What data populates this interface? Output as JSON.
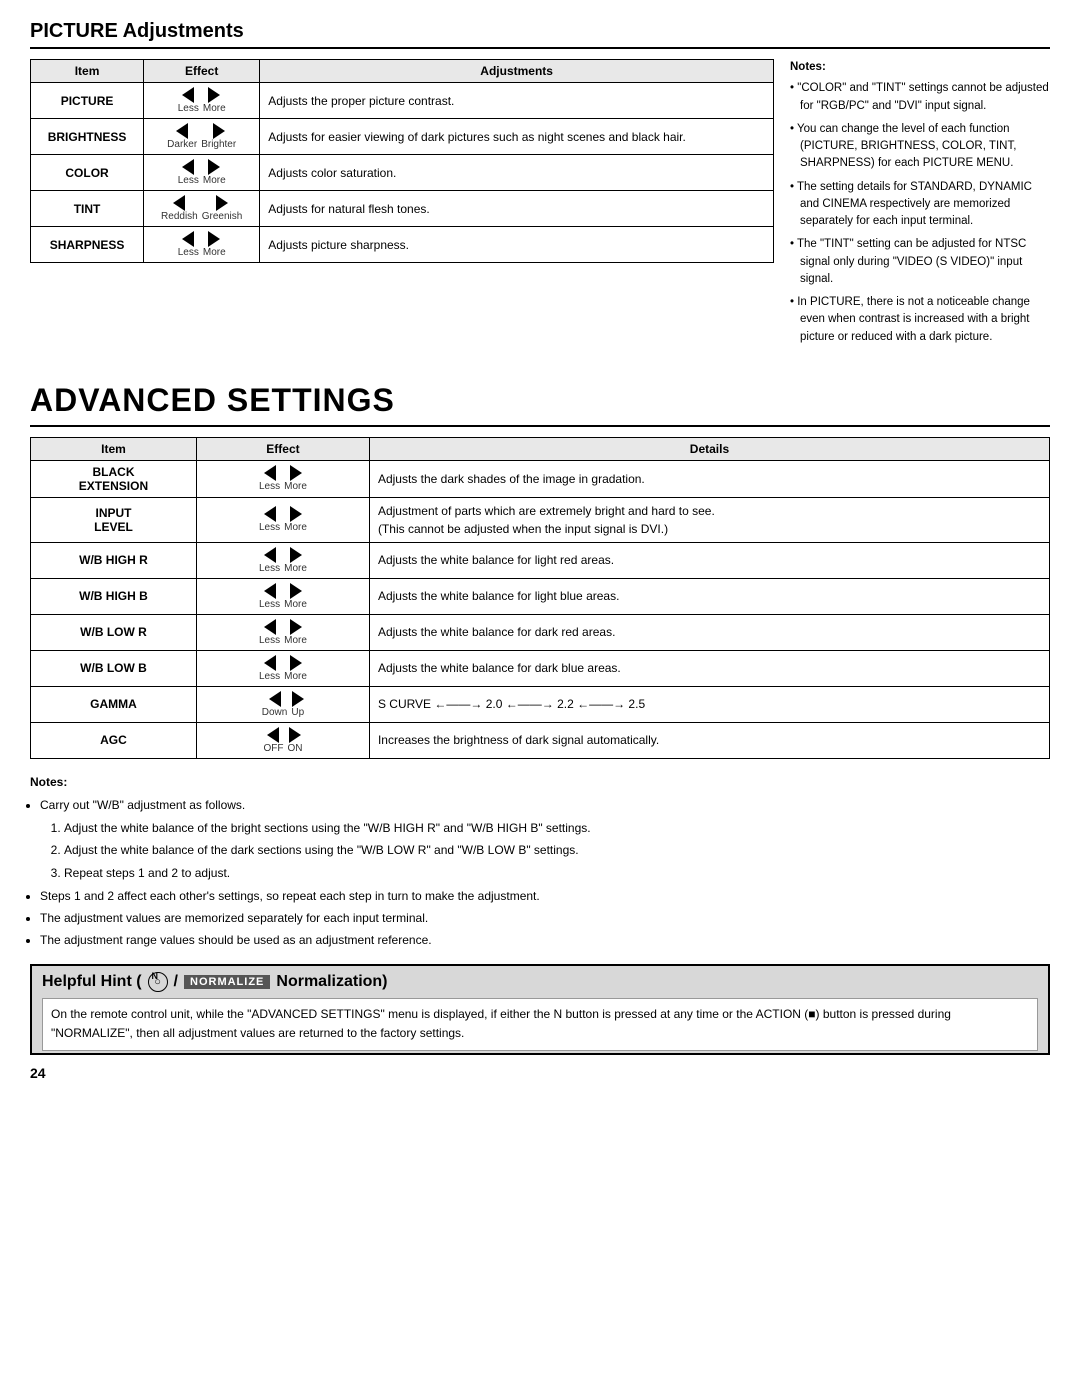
{
  "picture_adjustments": {
    "title": "PICTURE Adjustments",
    "table": {
      "headers": [
        "Item",
        "Effect",
        "Adjustments"
      ],
      "rows": [
        {
          "item": "PICTURE",
          "left_label": "Less",
          "right_label": "More",
          "adjustment": "Adjusts the proper picture contrast."
        },
        {
          "item": "BRIGHTNESS",
          "left_label": "Darker",
          "right_label": "Brighter",
          "adjustment": "Adjusts for easier viewing of dark pictures such as night scenes and black hair."
        },
        {
          "item": "COLOR",
          "left_label": "Less",
          "right_label": "More",
          "adjustment": "Adjusts color saturation."
        },
        {
          "item": "TINT",
          "left_label": "Reddish",
          "right_label": "Greenish",
          "adjustment": "Adjusts for natural flesh tones."
        },
        {
          "item": "SHARPNESS",
          "left_label": "Less",
          "right_label": "More",
          "adjustment": "Adjusts picture sharpness."
        }
      ]
    },
    "notes": {
      "title": "Notes:",
      "items": [
        "\"COLOR\" and \"TINT\" settings cannot be adjusted for \"RGB/PC\" and \"DVI\" input signal.",
        "You can change the level of each function (PICTURE, BRIGHTNESS, COLOR, TINT, SHARPNESS) for each PICTURE MENU.",
        "The setting details for STANDARD, DYNAMIC and CINEMA respectively are memorized separately for each input terminal.",
        "The \"TINT\" setting can be adjusted for NTSC signal only during \"VIDEO (S VIDEO)\" input signal.",
        "In PICTURE, there is not a noticeable change even when contrast is increased with a bright picture or reduced with a dark picture."
      ]
    }
  },
  "advanced_settings": {
    "title": "ADVANCED SETTINGS",
    "table": {
      "headers": [
        "Item",
        "Effect",
        "Details"
      ],
      "rows": [
        {
          "item": "BLACK\nEXTENSION",
          "left_label": "Less",
          "right_label": "More",
          "detail": "Adjusts the dark shades of the image in gradation."
        },
        {
          "item": "INPUT\nLEVEL",
          "left_label": "Less",
          "right_label": "More",
          "detail": "Adjustment of parts which are extremely bright and hard to see.\n(This cannot be adjusted when the input signal is DVI.)"
        },
        {
          "item": "W/B HIGH R",
          "left_label": "Less",
          "right_label": "More",
          "detail": "Adjusts the white balance for light red areas."
        },
        {
          "item": "W/B HIGH B",
          "left_label": "Less",
          "right_label": "More",
          "detail": "Adjusts the white balance for light blue areas."
        },
        {
          "item": "W/B LOW R",
          "left_label": "Less",
          "right_label": "More",
          "detail": "Adjusts the white balance for dark red areas."
        },
        {
          "item": "W/B LOW B",
          "left_label": "Less",
          "right_label": "More",
          "detail": "Adjusts the white balance for dark blue areas."
        },
        {
          "item": "GAMMA",
          "left_label": "Down",
          "right_label": "Up",
          "detail": "S CURVE ←——→ 2.0 ←——→ 2.2 ←——→ 2.5"
        },
        {
          "item": "AGC",
          "left_label": "OFF",
          "right_label": "ON",
          "detail": "Increases the brightness of dark signal automatically."
        }
      ]
    },
    "notes": {
      "title": "Notes:",
      "bullet1": "Carry out \"W/B\" adjustment as follows.",
      "ordered": [
        "Adjust the white balance of the bright sections using the \"W/B HIGH R\" and \"W/B HIGH B\" settings.",
        "Adjust the white balance of the dark sections using the \"W/B LOW R\" and \"W/B LOW B\" settings.",
        "Repeat steps 1 and 2 to adjust."
      ],
      "steps_note": "Steps 1 and 2 affect each other's settings, so repeat each step in turn to make the adjustment.",
      "bullet2": "The adjustment values are memorized separately for each input terminal.",
      "bullet3": "The adjustment range values should be used as an adjustment reference."
    }
  },
  "helpful_hint": {
    "title": "Helpful Hint (",
    "n_label": "N",
    "slash": "/",
    "normalize_label": "NORMALIZE",
    "normalize_suffix": "Normalization)",
    "body": "On the remote control unit, while the \"ADVANCED SETTINGS\" menu is displayed, if either the N button is pressed at any time or the ACTION (■) button is pressed during \"NORMALIZE\", then all adjustment values are returned to the factory settings."
  },
  "page_number": "24"
}
